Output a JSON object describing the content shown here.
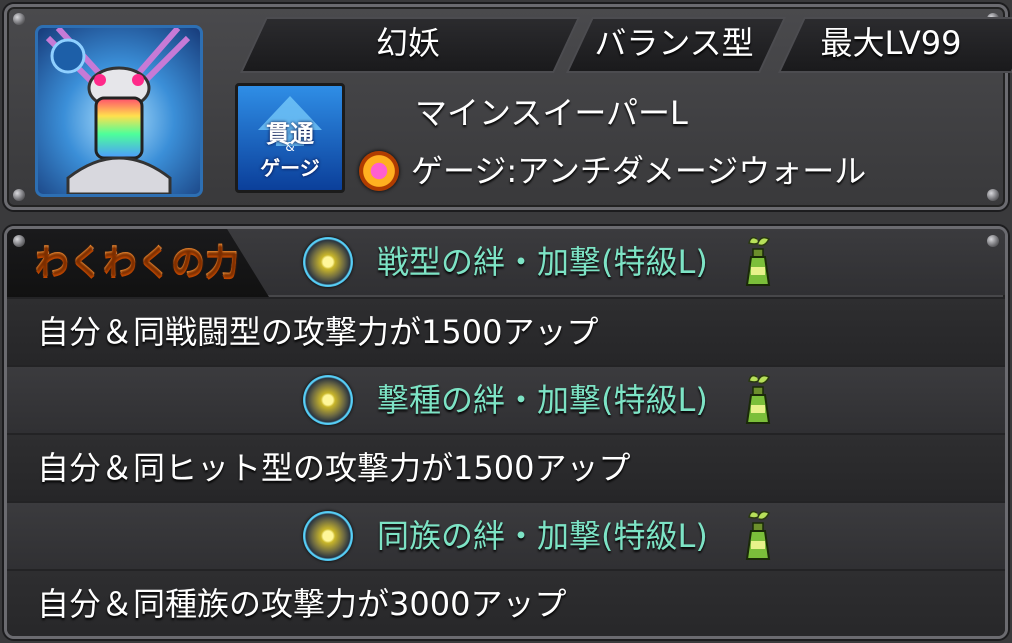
{
  "header": {
    "race": "幻妖",
    "type": "バランス型",
    "max_level": "最大LV99"
  },
  "ability": {
    "name": "マインスイーパーL",
    "gauge_line": "ゲージ:アンチダメージウォール",
    "gauge_badge_top": "貫通",
    "gauge_badge_amp": "&",
    "gauge_badge_bottom": "ゲージ"
  },
  "waku": {
    "tab_label": "わくわくの力",
    "items": [
      {
        "title": "戦型の絆・加撃(特級L)",
        "description": "自分＆同戦闘型の攻撃力が1500アップ"
      },
      {
        "title": "撃種の絆・加撃(特級L)",
        "description": "自分＆同ヒット型の攻撃力が1500アップ"
      },
      {
        "title": "同族の絆・加撃(特級L)",
        "description": "自分＆同種族の攻撃力が3000アップ"
      }
    ]
  },
  "icons": {
    "monster": "monster-portrait-icon",
    "gauge": "gauge-badge-icon",
    "ability_type": "fire-orb-icon",
    "skill": "bond-orb-icon",
    "bottle": "potion-bottle-icon"
  },
  "colors": {
    "skill_title": "#7de3c5",
    "panel_bg": "#3a3a3c"
  }
}
